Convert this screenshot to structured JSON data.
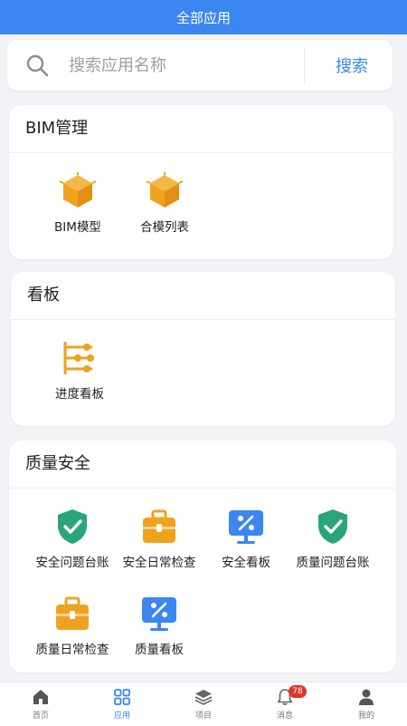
{
  "header": {
    "title": "全部应用"
  },
  "search": {
    "placeholder": "搜索应用名称",
    "button_label": "搜索"
  },
  "sections": [
    {
      "title": "BIM管理",
      "items": [
        {
          "label": "BIM模型"
        },
        {
          "label": "合模列表"
        }
      ]
    },
    {
      "title": "看板",
      "items": [
        {
          "label": "进度看板"
        }
      ]
    },
    {
      "title": "质量安全",
      "items": [
        {
          "label": "安全问题台账"
        },
        {
          "label": "安全日常检查"
        },
        {
          "label": "安全看板"
        },
        {
          "label": "质量问题台账"
        },
        {
          "label": "质量日常检查"
        },
        {
          "label": "质量看板"
        }
      ]
    }
  ],
  "tabbar": {
    "tabs": [
      {
        "label": "首页"
      },
      {
        "label": "应用"
      },
      {
        "label": "项目"
      },
      {
        "label": "消息",
        "badge": "78"
      },
      {
        "label": "我的"
      }
    ],
    "active": "应用"
  },
  "colors": {
    "accent": "#3c86f1",
    "orange": "#f0a21f",
    "green": "#2aa57a",
    "badge": "#e0362c"
  }
}
